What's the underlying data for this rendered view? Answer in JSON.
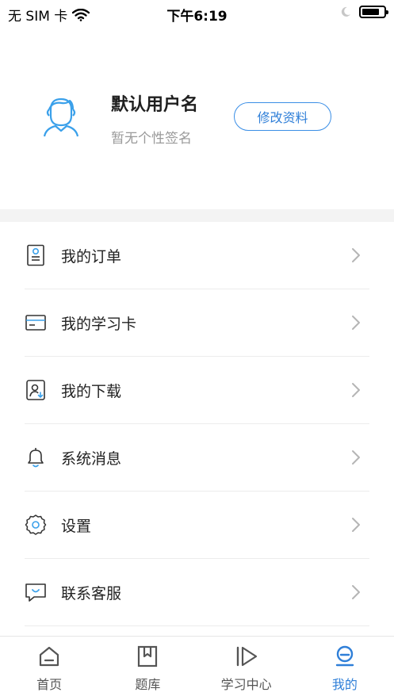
{
  "status_bar": {
    "carrier": "无 SIM 卡",
    "time": "下午6:19",
    "battery_level": 0.8
  },
  "profile": {
    "username": "默认用户名",
    "signature": "暂无个性签名",
    "edit_label": "修改资料"
  },
  "menu": {
    "items": [
      {
        "label": "我的订单",
        "icon": "order-icon"
      },
      {
        "label": "我的学习卡",
        "icon": "card-icon"
      },
      {
        "label": "我的下载",
        "icon": "download-icon"
      },
      {
        "label": "系统消息",
        "icon": "bell-icon"
      },
      {
        "label": "设置",
        "icon": "gear-icon"
      },
      {
        "label": "联系客服",
        "icon": "chat-icon"
      }
    ]
  },
  "tabbar": {
    "tabs": [
      {
        "label": "首页",
        "icon": "home-icon",
        "active": false
      },
      {
        "label": "题库",
        "icon": "bookmark-icon",
        "active": false
      },
      {
        "label": "学习中心",
        "icon": "play-icon",
        "active": false
      },
      {
        "label": "我的",
        "icon": "profile-icon",
        "active": true
      }
    ]
  },
  "colors": {
    "accent": "#2f7fd8",
    "accent_light": "#3aa0ea",
    "separator": "#f3f3f3"
  }
}
